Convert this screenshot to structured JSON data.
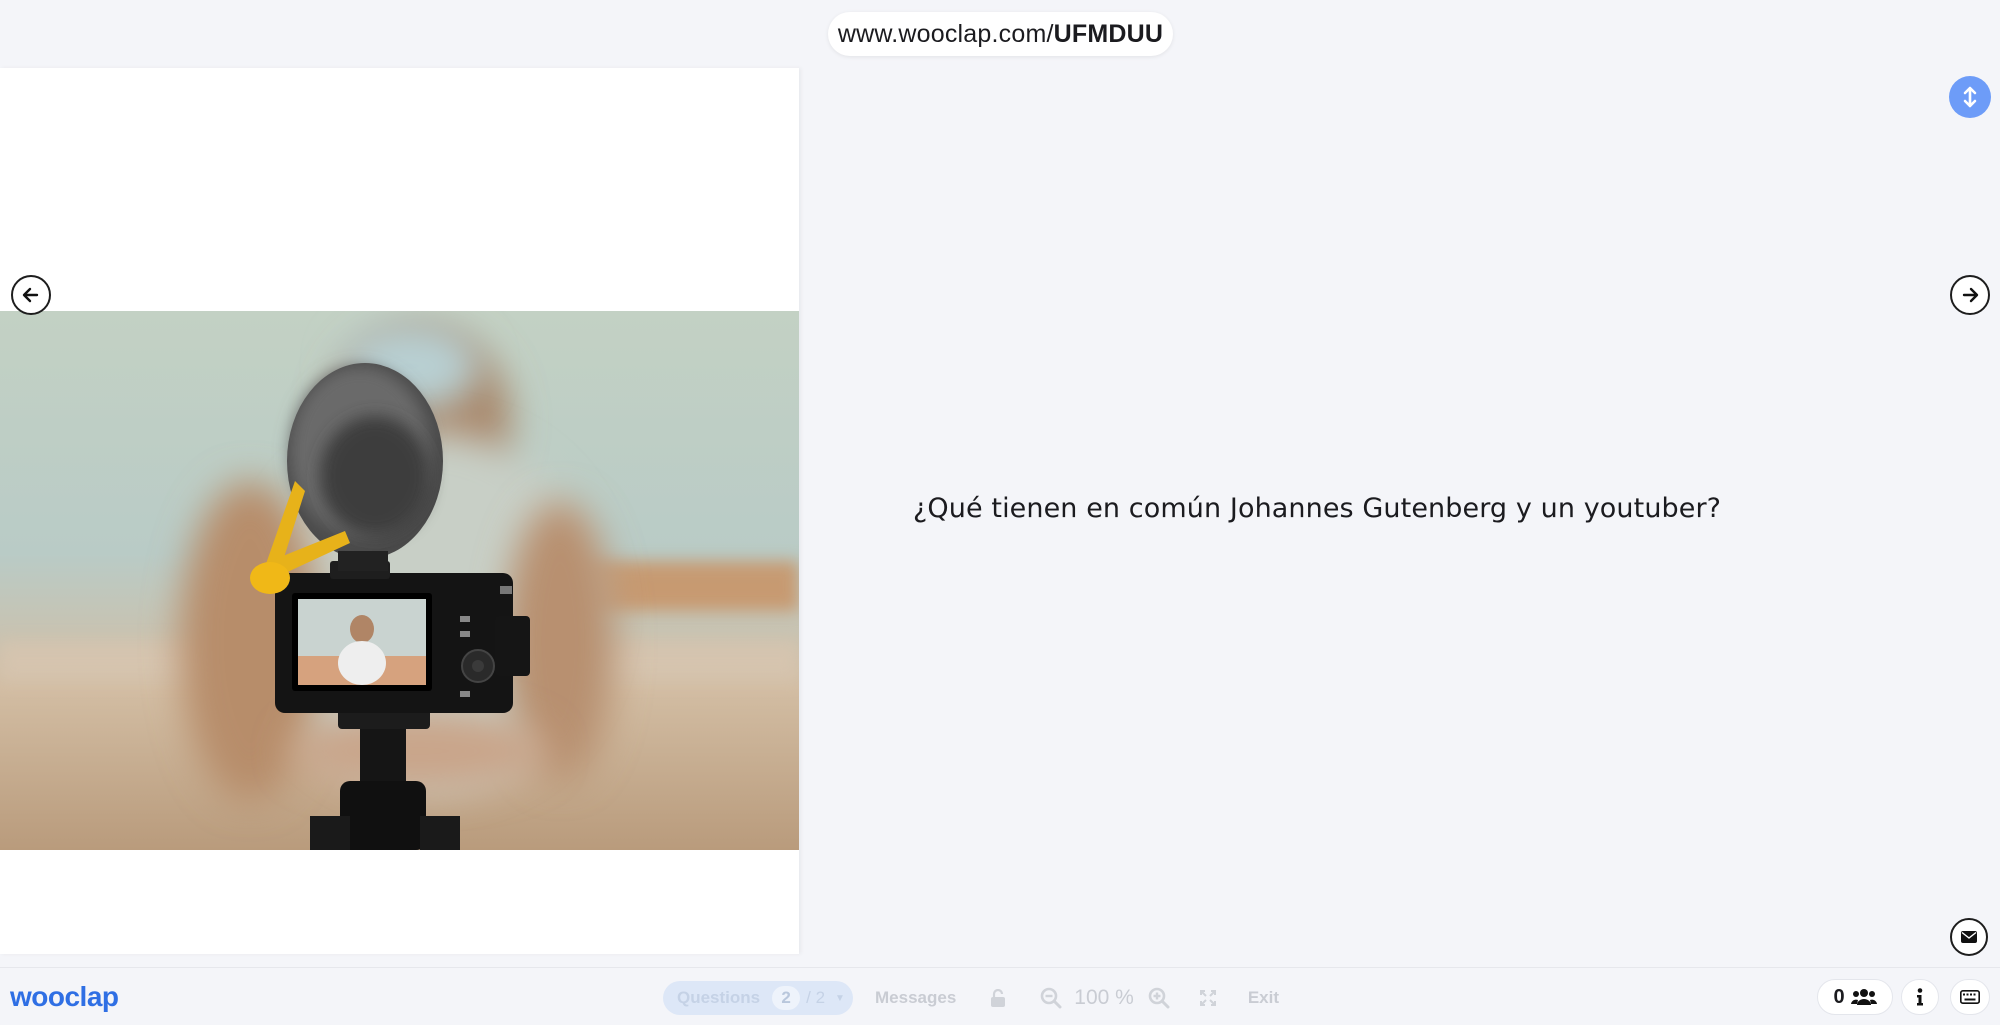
{
  "header": {
    "url_base": "www.wooclap.com/",
    "url_code": "UFMDUU"
  },
  "question": {
    "text": "¿Qué tienen en común Johannes Gutenberg y un youtuber?"
  },
  "toolbar": {
    "logo": "wooclap",
    "questions_label": "Questions",
    "question_current": "2",
    "question_total": "/ 2",
    "messages_label": "Messages",
    "zoom_value": "100 %",
    "exit_label": "Exit",
    "participants_count": "0"
  },
  "icons": {
    "prev": "arrow-left-icon",
    "next": "arrow-right-icon",
    "resize": "vertical-resize-icon",
    "mail": "envelope-icon",
    "lock": "unlock-icon",
    "zoom_out": "zoom-out-icon",
    "zoom_in": "zoom-in-icon",
    "fullscreen": "expand-icon",
    "participants": "users-icon",
    "info": "info-icon",
    "keyboard": "keyboard-icon"
  },
  "colors": {
    "accent": "#2f6fe4",
    "resize_button": "#6d9cf8"
  }
}
